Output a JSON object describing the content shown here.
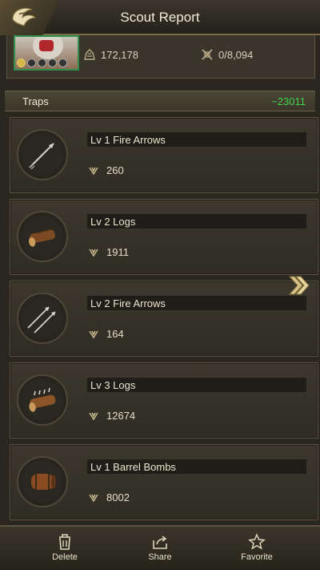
{
  "header": {
    "title": "Scout Report"
  },
  "player": {
    "power": "172,178",
    "troops": "0/8,094",
    "stars_filled": 1,
    "stars_total": 5
  },
  "traps": {
    "label": "Traps",
    "total": "~23011",
    "items": [
      {
        "name": "Lv 1 Fire Arrows",
        "count": "260",
        "icon": "fire-arrow-icon"
      },
      {
        "name": "Lv 2 Logs",
        "count": "1911",
        "icon": "log-icon"
      },
      {
        "name": "Lv 2 Fire Arrows",
        "count": "164",
        "icon": "double-arrow-icon"
      },
      {
        "name": "Lv 3 Logs",
        "count": "12674",
        "icon": "spiked-log-icon"
      },
      {
        "name": "Lv 1 Barrel Bombs",
        "count": "8002",
        "icon": "barrel-bomb-icon"
      }
    ]
  },
  "bottom_bar": {
    "delete_label": "Delete",
    "share_label": "Share",
    "favorite_label": "Favorite"
  },
  "colors": {
    "accent_green": "#3fd64a",
    "gold": "#d6b54a"
  }
}
